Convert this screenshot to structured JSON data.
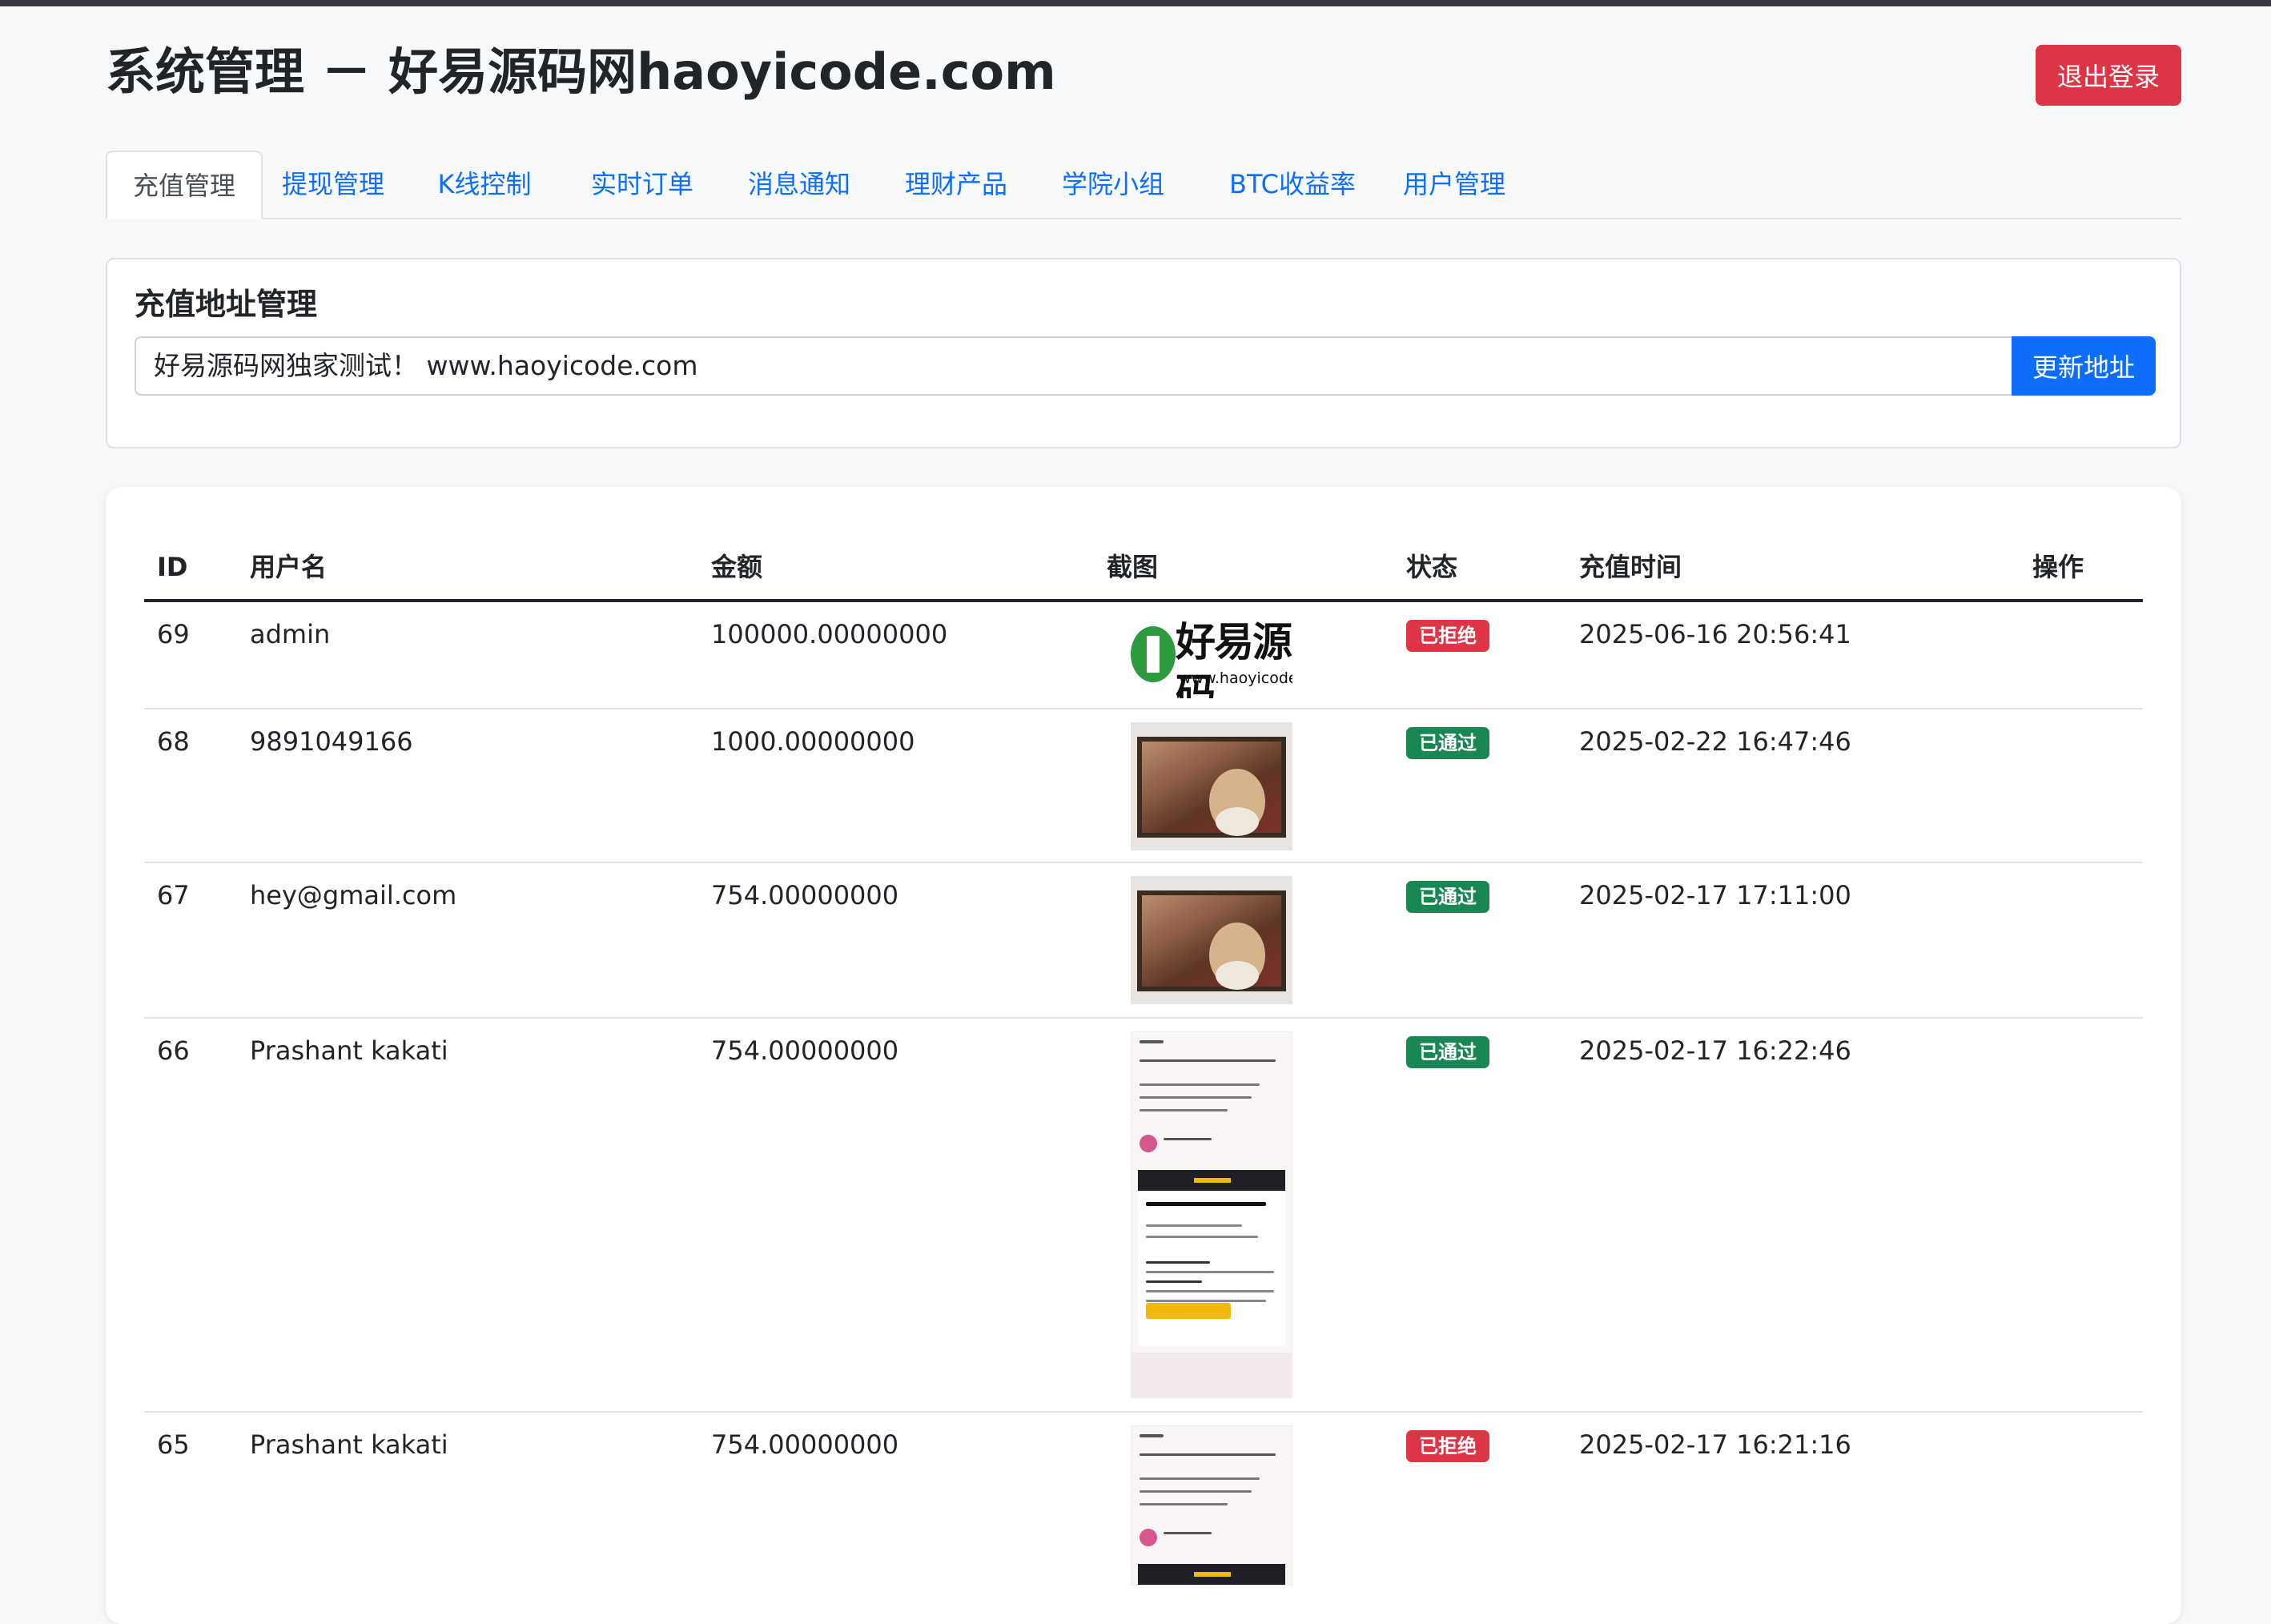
{
  "header": {
    "title": "系统管理 － 好易源码网haoyicode.com",
    "logout_label": "退出登录"
  },
  "tabs": [
    {
      "label": "充值管理",
      "active": true
    },
    {
      "label": "提现管理"
    },
    {
      "label": "K线控制"
    },
    {
      "label": "实时订单"
    },
    {
      "label": "消息通知"
    },
    {
      "label": "理财产品"
    },
    {
      "label": "学院小组"
    },
    {
      "label": "BTC收益率"
    },
    {
      "label": "用户管理"
    }
  ],
  "address_panel": {
    "title": "充值地址管理",
    "value": "好易源码网独家测试！ www.haoyicode.com",
    "button_label": "更新地址"
  },
  "table": {
    "headers": {
      "id": "ID",
      "username": "用户名",
      "amount": "金额",
      "screenshot": "截图",
      "status": "状态",
      "time": "充值时间",
      "actions": "操作"
    },
    "rows": [
      {
        "id": "69",
        "username": "admin",
        "amount": "100000.00000000",
        "status": "已拒绝",
        "status_type": "rejected",
        "time": "2025-06-16 20:56:41",
        "screenshot": "logo-image"
      },
      {
        "id": "68",
        "username": "9891049166",
        "amount": "1000.00000000",
        "status": "已通过",
        "status_type": "approved",
        "time": "2025-02-22 16:47:46",
        "screenshot": "portrait-image"
      },
      {
        "id": "67",
        "username": "hey@gmail.com",
        "amount": "754.00000000",
        "status": "已通过",
        "status_type": "approved",
        "time": "2025-02-17 17:11:00",
        "screenshot": "portrait-image"
      },
      {
        "id": "66",
        "username": "Prashant kakati",
        "amount": "754.00000000",
        "status": "已通过",
        "status_type": "approved",
        "time": "2025-02-17 16:22:46",
        "screenshot": "phone-email-image"
      },
      {
        "id": "65",
        "username": "Prashant kakati",
        "amount": "754.00000000",
        "status": "已拒绝",
        "status_type": "rejected",
        "time": "2025-02-17 16:21:16",
        "screenshot": "phone-email-image"
      }
    ]
  },
  "screenshot_texts": {
    "logo_text": "好易源码",
    "logo_url": "www.haoyicode.com"
  },
  "colors": {
    "primary": "#0d6efd",
    "danger": "#dc3545",
    "success": "#198754",
    "topbar": "#343a40"
  }
}
